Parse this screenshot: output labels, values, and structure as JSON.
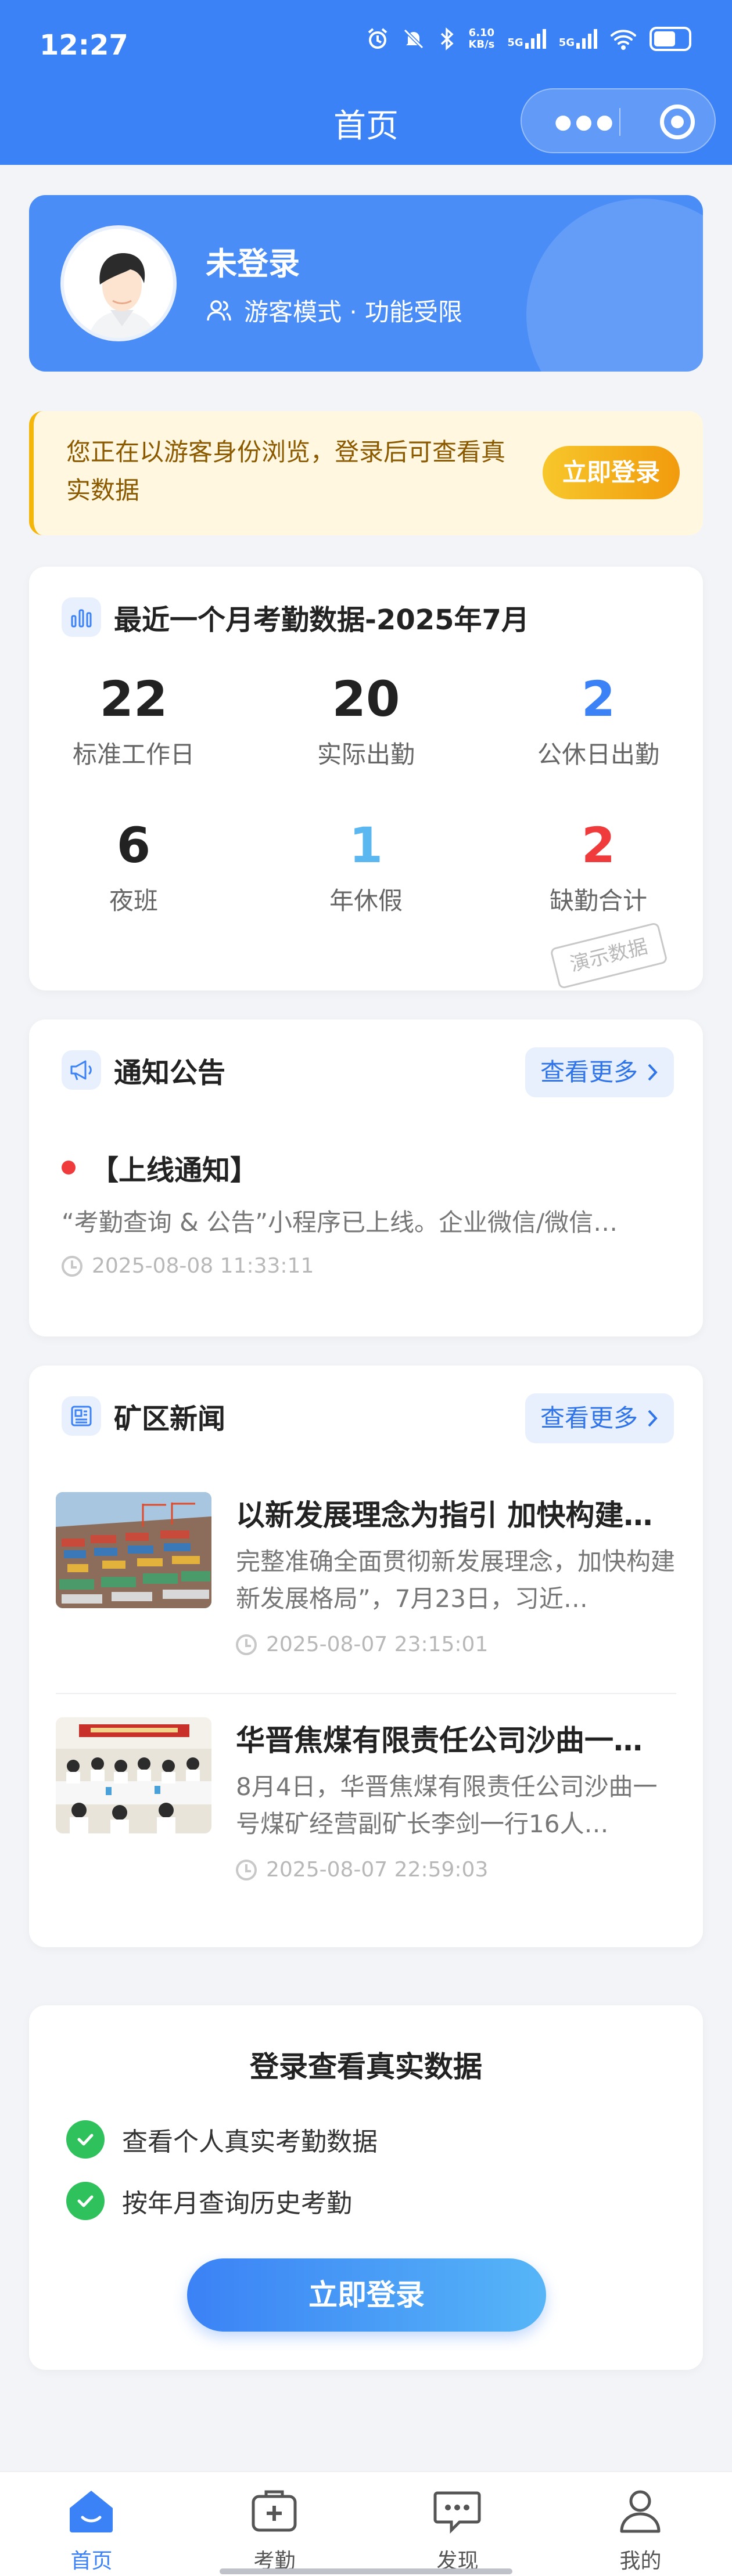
{
  "status_bar": {
    "time": "12:27",
    "net_speed_value": "6.10",
    "net_speed_unit": "KB/s",
    "signal1": "5G",
    "signal2": "5G"
  },
  "nav": {
    "title": "首页"
  },
  "profile": {
    "name": "未登录",
    "mode": "游客模式 · 功能受限"
  },
  "guest_alert": {
    "text": "您正在以游客身份浏览，登录后可查看真实数据",
    "button": "立即登录"
  },
  "attendance": {
    "title": "最近一个月考勤数据-2025年7月",
    "stats": [
      {
        "value": "22",
        "label": "标准工作日",
        "color": "#222222"
      },
      {
        "value": "20",
        "label": "实际出勤",
        "color": "#222222"
      },
      {
        "value": "2",
        "label": "公休日出勤",
        "color": "#3b82f6"
      },
      {
        "value": "6",
        "label": "夜班",
        "color": "#222222"
      },
      {
        "value": "1",
        "label": "年休假",
        "color": "#5bb7f0"
      },
      {
        "value": "2",
        "label": "缺勤合计",
        "color": "#ef3b3b"
      }
    ],
    "stamp": "演示数据"
  },
  "notice": {
    "title": "通知公告",
    "more": "查看更多",
    "item": {
      "title": "【上线通知】",
      "body": "“考勤查询 & 公告”小程序已上线。企业微信/微信…",
      "time": "2025-08-08 11:33:11"
    }
  },
  "news": {
    "title": "矿区新闻",
    "more": "查看更多",
    "items": [
      {
        "title": "以新发展理念为指引 加快构建…",
        "body": "完整准确全面贯彻新发展理念，加快构建新发展格局”，7月23日，习近…",
        "time": "2025-08-07 23:15:01"
      },
      {
        "title": "华晋焦煤有限责任公司沙曲一…",
        "body": "8月4日，华晋焦煤有限责任公司沙曲一号煤矿经营副矿长李剑一行16人…",
        "time": "2025-08-07 22:59:03"
      }
    ]
  },
  "login_panel": {
    "title": "登录查看真实数据",
    "features": [
      "查看个人真实考勤数据",
      "按年月查询历史考勤"
    ],
    "button": "立即登录"
  },
  "tabbar": {
    "items": [
      {
        "label": "首页",
        "icon": "home-icon",
        "active": true
      },
      {
        "label": "考勤",
        "icon": "medical-kit-icon",
        "active": false
      },
      {
        "label": "发现",
        "icon": "chat-bubble-icon",
        "active": false
      },
      {
        "label": "我的",
        "icon": "person-icon",
        "active": false
      }
    ]
  },
  "colors": {
    "primary": "#3b82f6",
    "warning": "#f5b60a",
    "success": "#2fc15b",
    "danger": "#ef3b3b"
  }
}
